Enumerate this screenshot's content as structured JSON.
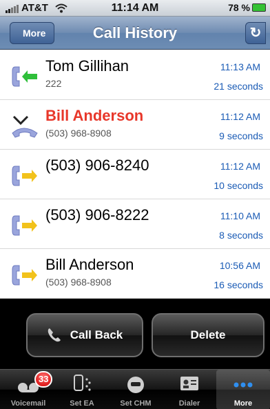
{
  "status_bar": {
    "carrier": "AT&T",
    "time": "11:14 AM",
    "battery": "78 %"
  },
  "nav": {
    "back_label": "More",
    "title": "Call History",
    "refresh_icon": "refresh-icon"
  },
  "calls": [
    {
      "name": "Tom Gillihan",
      "detail": "222",
      "time": "11:13 AM",
      "duration": "21 seconds",
      "type": "incoming",
      "missed": false
    },
    {
      "name": "Bill Anderson",
      "detail": "(503) 968-8908",
      "time": "11:12 AM",
      "duration": "9 seconds",
      "type": "missed",
      "missed": true
    },
    {
      "name": "(503) 906-8240",
      "detail": "",
      "time": "11:12 AM",
      "duration": "10 seconds",
      "type": "outgoing",
      "missed": false
    },
    {
      "name": "(503) 906-8222",
      "detail": "",
      "time": "11:10 AM",
      "duration": "8 seconds",
      "type": "outgoing",
      "missed": false
    },
    {
      "name": "Bill Anderson",
      "detail": "(503) 968-8908",
      "time": "10:56 AM",
      "duration": "16 seconds",
      "type": "outgoing",
      "missed": false
    }
  ],
  "actions": {
    "call_back": "Call Back",
    "delete": "Delete"
  },
  "tabs": [
    {
      "label": "Voicemail",
      "badge": "33",
      "icon": "voicemail-icon"
    },
    {
      "label": "Set EA",
      "icon": "phone-dots-icon"
    },
    {
      "label": "Set CHM",
      "icon": "rotary-phone-icon"
    },
    {
      "label": "Dialer",
      "icon": "contact-card-icon"
    },
    {
      "label": "More",
      "icon": "more-dots-icon",
      "active": true
    }
  ],
  "colors": {
    "missed": "#e8372a",
    "accent_blue": "#1a5bb5",
    "incoming_arrow": "#2fbf3a",
    "outgoing_arrow": "#f2c21b"
  }
}
